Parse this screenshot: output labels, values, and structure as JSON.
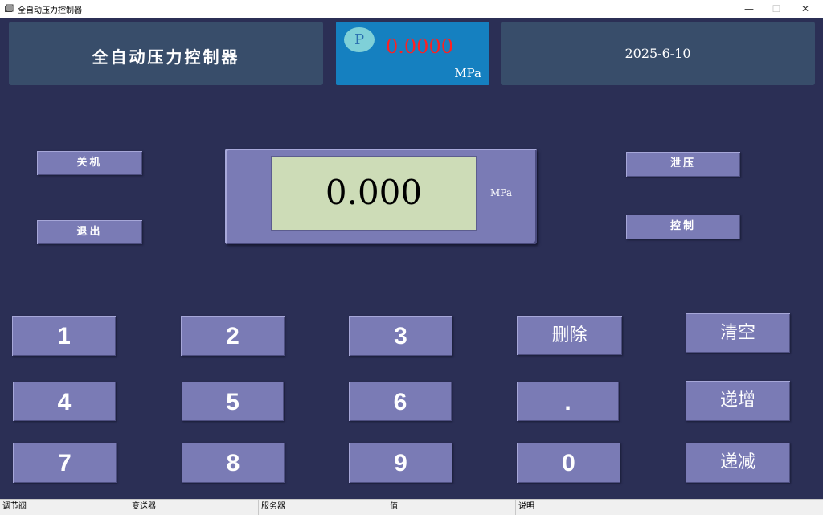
{
  "window": {
    "title": "全自动压力控制器",
    "minimize_icon": "—",
    "maximize_icon": "☐",
    "close_icon": "✕"
  },
  "header": {
    "title": "全自动压力控制器",
    "pressure_symbol": "P",
    "pressure_value": "0.0000",
    "pressure_unit": "MPa",
    "date": "2025-6-10"
  },
  "display": {
    "value": "0.000",
    "unit": "MPa"
  },
  "buttons": {
    "shutdown": "关机",
    "exit": "退出",
    "release": "泄压",
    "control": "控制"
  },
  "keypad": {
    "k1": "1",
    "k2": "2",
    "k3": "3",
    "k4": "4",
    "k5": "5",
    "k6": "6",
    "k7": "7",
    "k8": "8",
    "k9": "9",
    "k0": "0",
    "dot": ".",
    "delete": "删除",
    "clear": "清空",
    "increment": "递增",
    "decrement": "递减"
  },
  "statusbar": {
    "valve": "调节阀",
    "transmitter": "变送器",
    "server": "服务器",
    "value": "值",
    "description": "说明"
  },
  "colors": {
    "background": "#2b2f55",
    "button": "#7a7bb5",
    "header_panel": "#384d6a",
    "pressure_panel": "#1580c0",
    "pressure_value": "#ff2020",
    "lcd": "#cddcb7"
  }
}
